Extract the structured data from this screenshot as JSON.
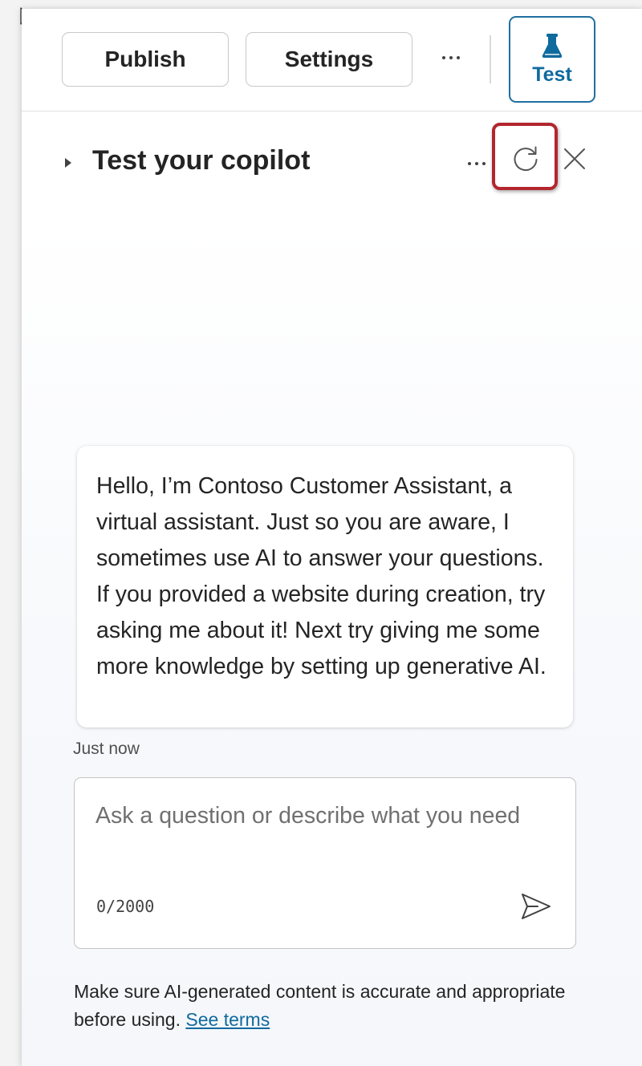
{
  "toolbar": {
    "publish_label": "Publish",
    "settings_label": "Settings",
    "more_icon": "more-horizontal-icon",
    "test_label": "Test",
    "test_icon": "beaker-icon"
  },
  "pane": {
    "title": "Test your copilot",
    "more_icon": "more-horizontal-icon",
    "refresh_icon": "refresh-icon",
    "close_icon": "close-icon",
    "highlight_color": "#b3262e"
  },
  "conversation": {
    "messages": [
      {
        "text": "Hello, I’m Contoso Customer Assistant, a virtual assistant. Just so you are aware, I sometimes use AI to answer your questions. If you provided a website during creation, try asking me about it! Next try giving me some more knowledge by setting up generative AI.",
        "timestamp": "Just now"
      }
    ]
  },
  "composer": {
    "placeholder": "Ask a question or describe what you need",
    "value": "",
    "counter": "0/2000",
    "send_icon": "send-icon"
  },
  "footer": {
    "disclaimer": "Make sure AI-generated content is accurate and appropriate before using.",
    "terms_link": "See terms"
  },
  "colors": {
    "accent": "#0f6a9e",
    "border": "#c8c8c8"
  }
}
